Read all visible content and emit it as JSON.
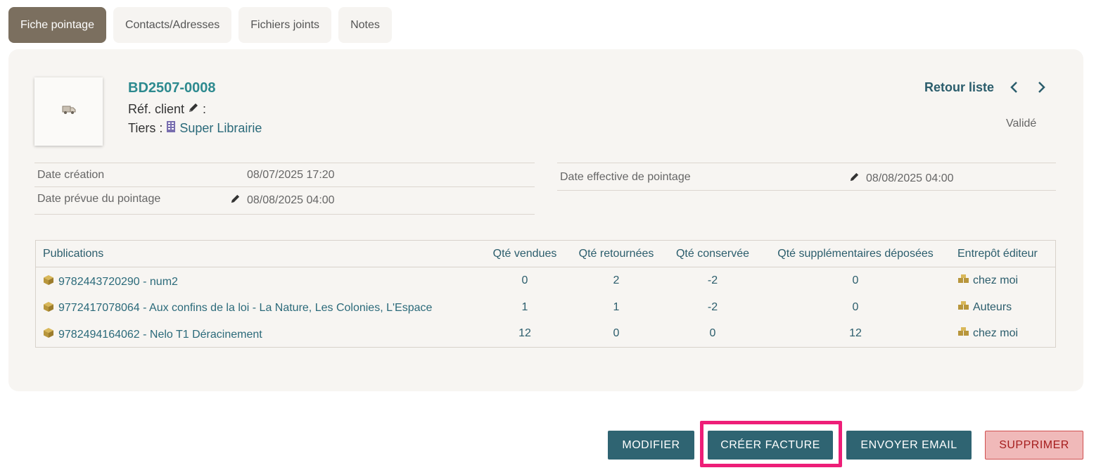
{
  "tabs": [
    {
      "label": "Fiche pointage",
      "active": true
    },
    {
      "label": "Contacts/Adresses",
      "active": false
    },
    {
      "label": "Fichiers joints",
      "active": false
    },
    {
      "label": "Notes",
      "active": false
    }
  ],
  "record": {
    "ref": "BD2507-0008",
    "ref_client_label": "Réf. client",
    "ref_client_sep": ":",
    "tiers_label": "Tiers :",
    "tiers_value": "Super Librairie",
    "status": "Validé"
  },
  "nav": {
    "back_label": "Retour liste"
  },
  "dates": {
    "creation_label": "Date création",
    "creation_value": "08/07/2025 17:20",
    "prevue_label": "Date prévue du pointage",
    "prevue_value": "08/08/2025 04:00",
    "effective_label": "Date effective de pointage",
    "effective_value": "08/08/2025 04:00"
  },
  "table": {
    "headers": [
      "Publications",
      "Qté vendues",
      "Qté retournées",
      "Qté conservée",
      "Qté supplémentaires déposées",
      "Entrepôt éditeur"
    ],
    "rows": [
      {
        "publication": "9782443720290 - num2",
        "vendues": "0",
        "retournees": "2",
        "conservee": "-2",
        "supplementaires": "0",
        "entrepot": "chez moi"
      },
      {
        "publication": "9772417078064 - Aux confins de la loi - La Nature, Les Colonies, L'Espace",
        "vendues": "1",
        "retournees": "1",
        "conservee": "-2",
        "supplementaires": "0",
        "entrepot": "Auteurs"
      },
      {
        "publication": "9782494164062 - Nelo T1 Déracinement",
        "vendues": "12",
        "retournees": "0",
        "conservee": "0",
        "supplementaires": "12",
        "entrepot": "chez moi"
      }
    ]
  },
  "actions": {
    "modifier": "MODIFIER",
    "creer_facture": "CRÉER FACTURE",
    "envoyer_email": "ENVOYER EMAIL",
    "supprimer": "SUPPRIMER"
  },
  "colors": {
    "accent": "#2f6472",
    "tab_active": "#7b6f5f",
    "highlight": "#ee1e78",
    "danger_bg": "#f0b9b9",
    "box_icon": "#b8963c"
  },
  "icons": [
    "truck-icon",
    "pencil-icon",
    "building-icon",
    "chevron-left-icon",
    "chevron-right-icon",
    "box-icon",
    "boxes-icon"
  ]
}
